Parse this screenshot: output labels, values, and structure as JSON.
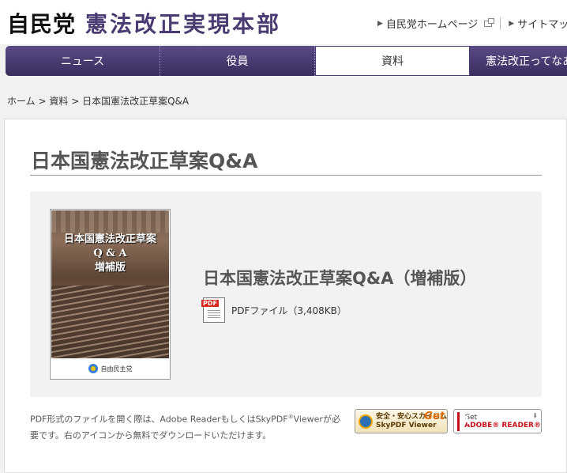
{
  "header": {
    "logo_party": "自民党",
    "logo_hq": "憲法改正実現本部",
    "links": [
      {
        "label": "自民党ホームページ",
        "icon": "external-link-icon"
      },
      {
        "label": "サイトマップ",
        "icon": "arrow-right-icon"
      }
    ]
  },
  "nav": {
    "items": [
      {
        "label": "ニュース"
      },
      {
        "label": "役員"
      },
      {
        "label": "資料",
        "active": true
      },
      {
        "label": "憲法改正ってなあに"
      }
    ]
  },
  "breadcrumb": {
    "home": "ホーム",
    "section": "資料",
    "current": "日本国憲法改正草案Q&A",
    "separator": ">"
  },
  "page": {
    "title": "日本国憲法改正草案Q&A",
    "document": {
      "cover_title_line1": "日本国憲法改正草案",
      "cover_title_line2": "Q & A",
      "cover_title_line3": "増補版",
      "cover_footer": "自由民主党",
      "title": "日本国憲法改正草案Q&A（増補版）",
      "file_label": "PDFファイル（3,408KB）"
    },
    "note_part1": "PDF形式のファイルを開く際は、Adobe ReaderもしくはSkyPDF",
    "note_reg": "®",
    "note_part2": "Viewerが必要です。右のアイコンから無料でダウンロードいただけます。",
    "badges": {
      "sky_line1": "安全・安心スカイコム",
      "sky_line2": "SkyPDF Viewer",
      "sky_get": "Get",
      "adobe_line1": "Get",
      "adobe_line2": "ADOBE® READER®"
    }
  }
}
